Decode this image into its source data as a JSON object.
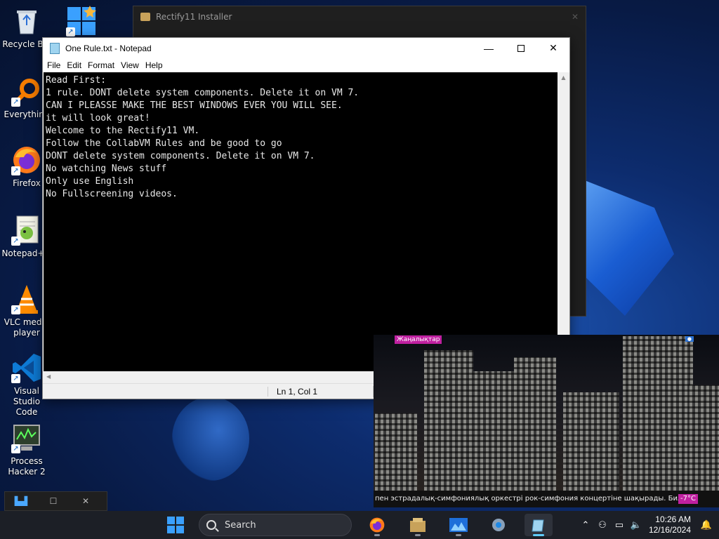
{
  "desktop": {
    "icons": [
      {
        "label": "Recycle Bin",
        "icon": "recycle-bin-icon"
      },
      {
        "label": "",
        "icon": "windows-shortcut-icon"
      },
      {
        "label": "Everything",
        "icon": "everything-search-icon"
      },
      {
        "label": "Firefox",
        "icon": "firefox-icon"
      },
      {
        "label": "Notepad++",
        "icon": "notepad-plus-plus-icon"
      },
      {
        "label": "VLC media player",
        "icon": "vlc-icon"
      },
      {
        "label": "Visual Studio Code",
        "icon": "vscode-icon"
      },
      {
        "label": "Process Hacker 2",
        "icon": "process-hacker-icon"
      }
    ]
  },
  "installer": {
    "title": "Rectify11 Installer"
  },
  "notepad": {
    "title": "One Rule.txt - Notepad",
    "menu": [
      "File",
      "Edit",
      "Format",
      "View",
      "Help"
    ],
    "content": "Read First:\n1 rule. DONT delete system components. Delete it on VM 7.\nCAN I PLEASSE MAKE THE BEST WINDOWS EVER YOU WILL SEE.\nit will look great!\nWelcome to the Rectify11 VM.\nFollow the CollabVM Rules and be good to go\nDONT delete system components. Delete it on VM 7.\nNo watching News stuff\nOnly use English\nNo Fullscreening videos.",
    "status_position": "Ln 1, Col 1"
  },
  "video": {
    "badge": "Жаңалықтар",
    "ticker": "пен эстрадалық-симфониялық оркестрі рок-симфония концертіне шақырады. Биле",
    "temperature": "-7°C"
  },
  "taskbar": {
    "search_label": "Search",
    "time": "10:26 AM",
    "date": "12/16/2024"
  },
  "colors": {
    "accent": "#60cdff",
    "taskbar": "#1c1f26",
    "editor_bg": "#000000"
  }
}
